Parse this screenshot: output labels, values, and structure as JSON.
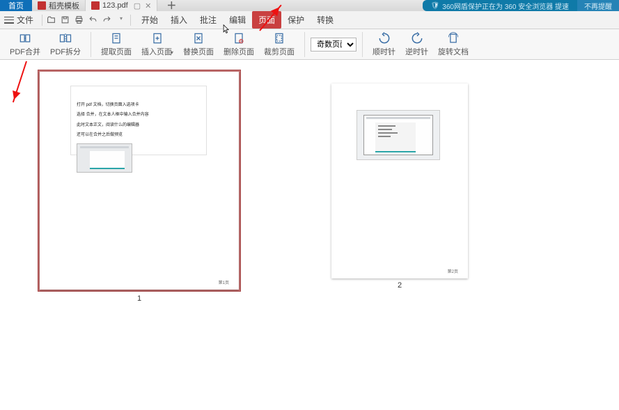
{
  "topbar": {
    "home": "首页",
    "tab2": "稻壳模板",
    "tab3": "123.pdf",
    "banner_main": "360网盾保护正在为 360 安全浏览器 提速",
    "banner_side": "不再提醒"
  },
  "menu": {
    "file": "文件",
    "tabs": {
      "start": "开始",
      "insert": "插入",
      "annotate": "批注",
      "edit": "编辑",
      "page": "页面",
      "protect": "保护",
      "convert": "转换"
    }
  },
  "ribbon": {
    "merge": "PDF合并",
    "split": "PDF拆分",
    "extract": "提取页面",
    "insert": "插入页面",
    "replace": "替换页面",
    "delete": "删除页面",
    "crop": "裁剪页面",
    "page_select": "奇数页面",
    "cw": "顺时针",
    "ccw": "逆时针",
    "rotate_doc": "旋转文档"
  },
  "thumbs": {
    "p1_lines": [
      "打开 pdf 文档，切换页面入选项卡",
      "选择 合并，在文本人框中输入合并内容",
      "此时文本正文，阅读什么的编辑器",
      "还可以在合并之后做预览"
    ],
    "p1_pglabel": "第1页",
    "p2_pglabel": "第2页",
    "n1": "1",
    "n2": "2"
  }
}
